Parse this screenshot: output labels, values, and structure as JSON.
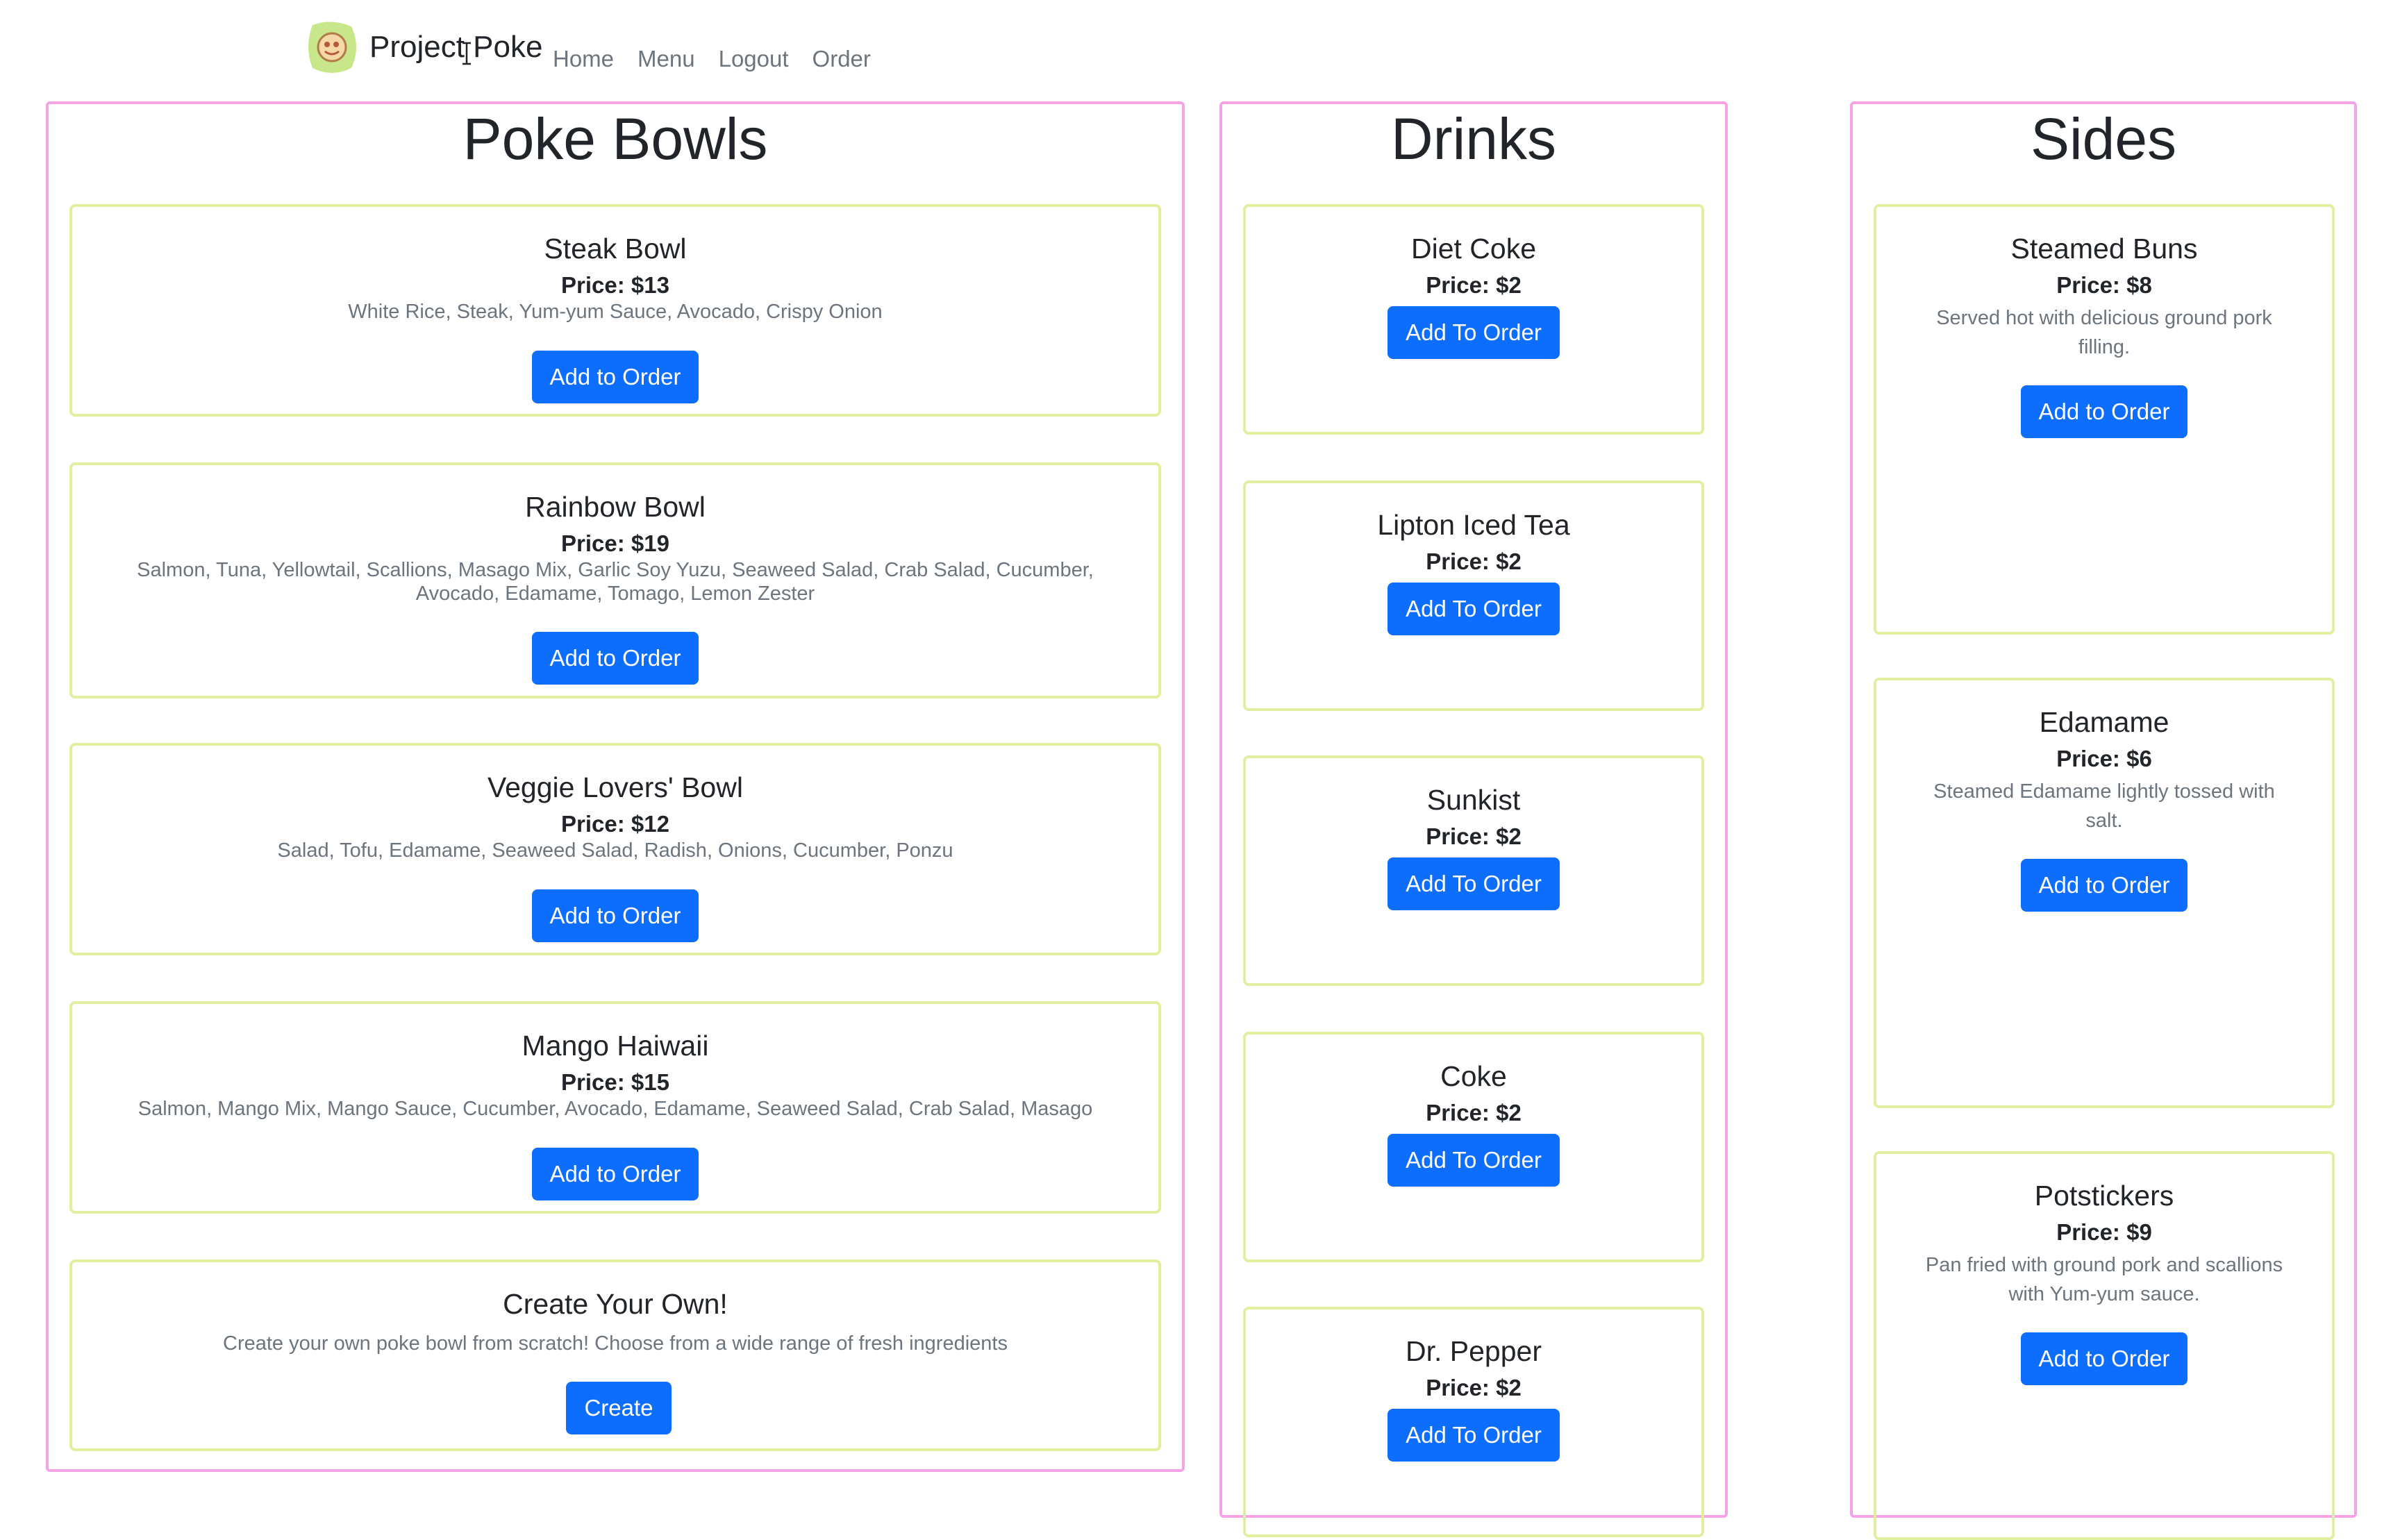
{
  "navbar": {
    "brand": "Project Poke",
    "links": [
      "Home",
      "Menu",
      "Logout",
      "Order"
    ]
  },
  "bowls": {
    "title": "Poke Bowls",
    "items": [
      {
        "name": "Steak Bowl",
        "price": "Price: $13",
        "desc": "White Rice, Steak, Yum-yum Sauce, Avocado, Crispy Onion",
        "button": "Add to Order"
      },
      {
        "name": "Rainbow Bowl",
        "price": "Price: $19",
        "desc": "Salmon, Tuna, Yellowtail, Scallions, Masago Mix, Garlic Soy Yuzu, Seaweed Salad, Crab Salad, Cucumber, Avocado, Edamame, Tomago, Lemon Zester",
        "button": "Add to Order"
      },
      {
        "name": "Veggie Lovers' Bowl",
        "price": "Price: $12",
        "desc": "Salad, Tofu, Edamame, Seaweed Salad, Radish, Onions, Cucumber, Ponzu",
        "button": "Add to Order"
      },
      {
        "name": "Mango Haiwaii",
        "price": "Price: $15",
        "desc": "Salmon, Mango Mix, Mango Sauce, Cucumber, Avocado, Edamame, Seaweed Salad, Crab Salad, Masago",
        "button": "Add to Order"
      }
    ],
    "create": {
      "name": "Create Your Own!",
      "desc": "Create your own poke bowl from scratch! Choose from a wide range of fresh ingredients",
      "button": "Create"
    }
  },
  "drinks": {
    "title": "Drinks",
    "items": [
      {
        "name": "Diet Coke",
        "price": "Price: $2",
        "button": "Add To Order"
      },
      {
        "name": "Lipton Iced Tea",
        "price": "Price: $2",
        "button": "Add To Order"
      },
      {
        "name": "Sunkist",
        "price": "Price: $2",
        "button": "Add To Order"
      },
      {
        "name": "Coke",
        "price": "Price: $2",
        "button": "Add To Order"
      },
      {
        "name": "Dr. Pepper",
        "price": "Price: $2",
        "button": "Add To Order"
      }
    ]
  },
  "sides": {
    "title": "Sides",
    "items": [
      {
        "name": "Steamed Buns",
        "price": "Price: $8",
        "desc": "Served hot with delicious ground pork filling.",
        "button": "Add to Order"
      },
      {
        "name": "Edamame",
        "price": "Price: $6",
        "desc": "Steamed Edamame lightly tossed with salt.",
        "button": "Add to Order"
      },
      {
        "name": "Potstickers",
        "price": "Price: $9",
        "desc": "Pan fried with ground pork and scallions with Yum-yum sauce.",
        "button": "Add to Order"
      }
    ]
  },
  "colors": {
    "primary": "#0d6efd",
    "column_border": "#f4a4e6",
    "card_border": "#e1f0a0",
    "muted_text": "#6c757d"
  }
}
